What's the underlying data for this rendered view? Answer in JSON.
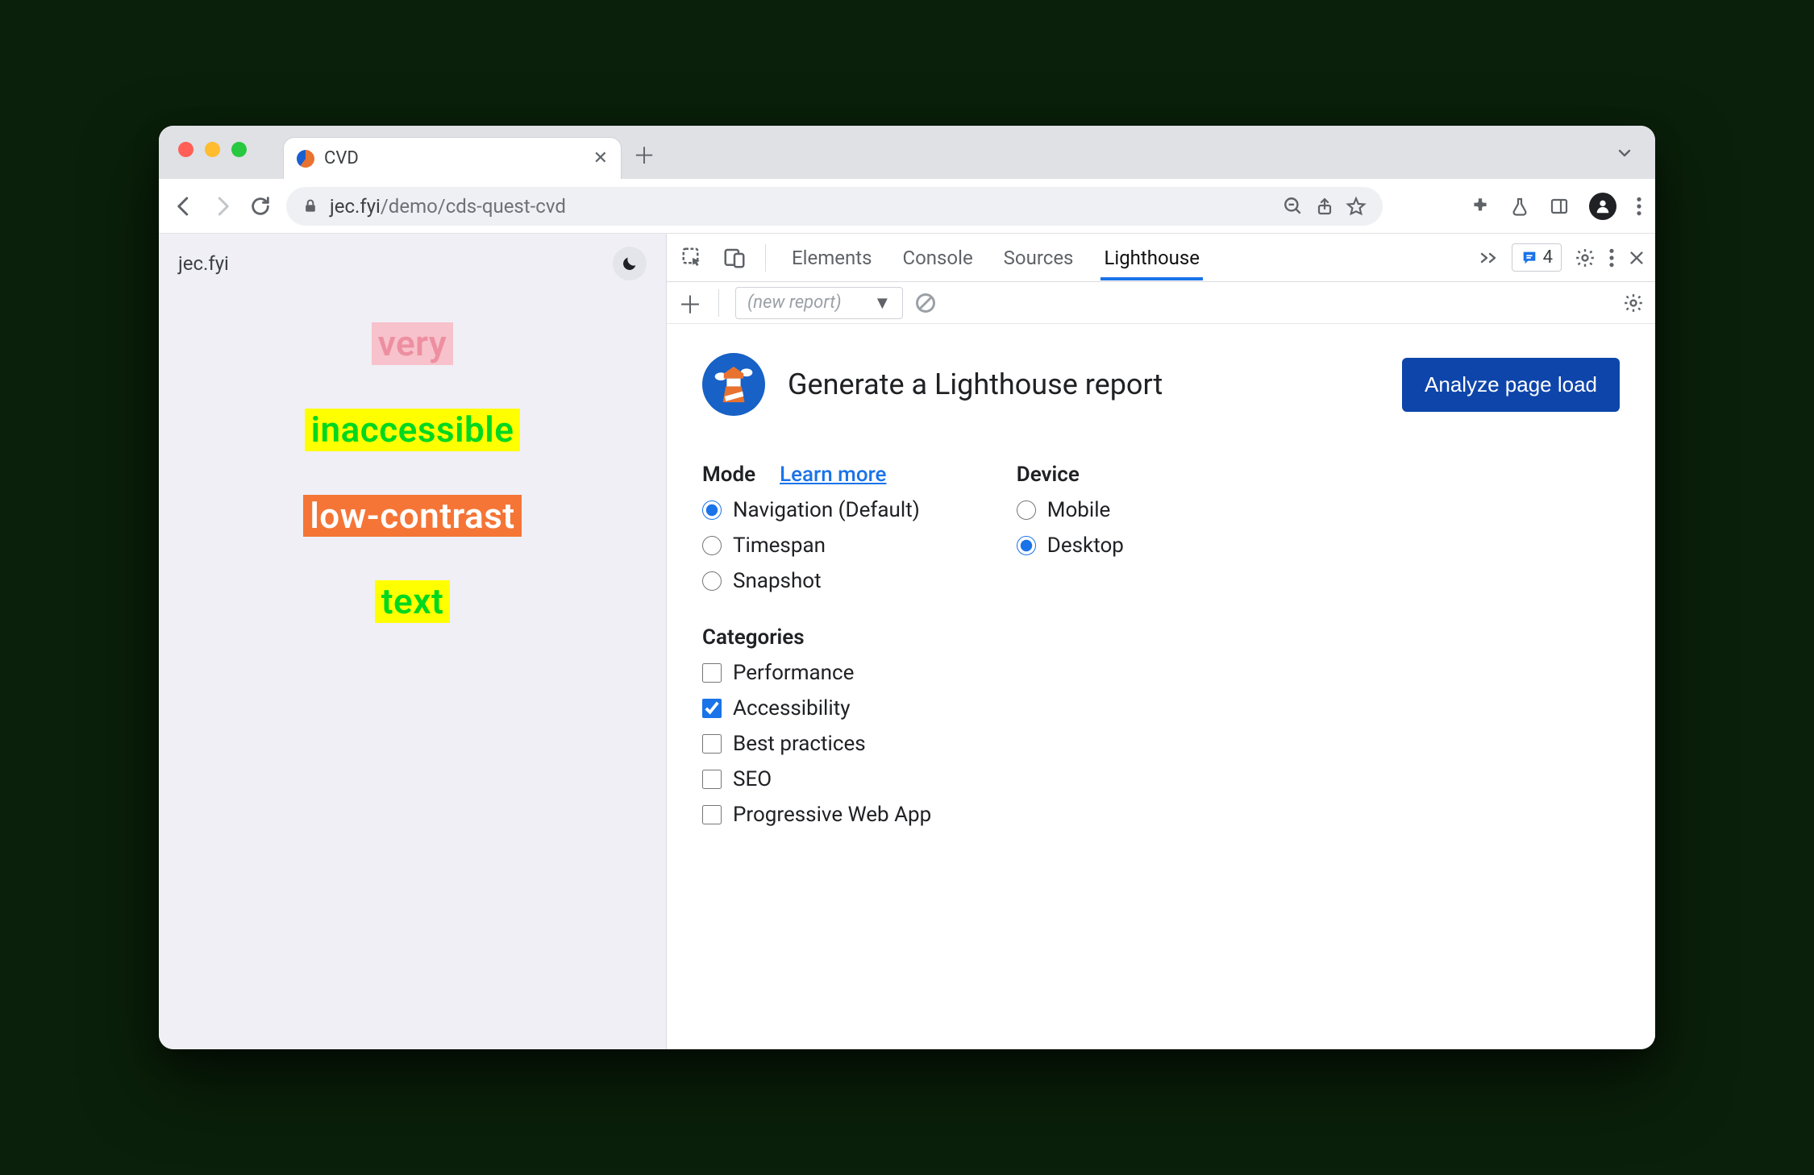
{
  "browser": {
    "tab_title": "CVD",
    "url_host": "jec.fyi",
    "url_path": "/demo/cds-quest-cvd"
  },
  "page": {
    "site_label": "jec.fyi",
    "samples": {
      "line1": "very",
      "line2": "inaccessible",
      "line3": "low-contrast",
      "line4": "text"
    }
  },
  "devtools": {
    "tabs": {
      "elements": "Elements",
      "console": "Console",
      "sources": "Sources",
      "lighthouse": "Lighthouse"
    },
    "issues_count": "4",
    "report_select": "(new report)"
  },
  "lighthouse": {
    "title": "Generate a Lighthouse report",
    "cta": "Analyze page load",
    "mode": {
      "heading": "Mode",
      "learn_more": "Learn more",
      "options": {
        "navigation": "Navigation (Default)",
        "timespan": "Timespan",
        "snapshot": "Snapshot"
      }
    },
    "device": {
      "heading": "Device",
      "options": {
        "mobile": "Mobile",
        "desktop": "Desktop"
      }
    },
    "categories": {
      "heading": "Categories",
      "options": {
        "performance": "Performance",
        "accessibility": "Accessibility",
        "best_practices": "Best practices",
        "seo": "SEO",
        "pwa": "Progressive Web App"
      }
    }
  }
}
